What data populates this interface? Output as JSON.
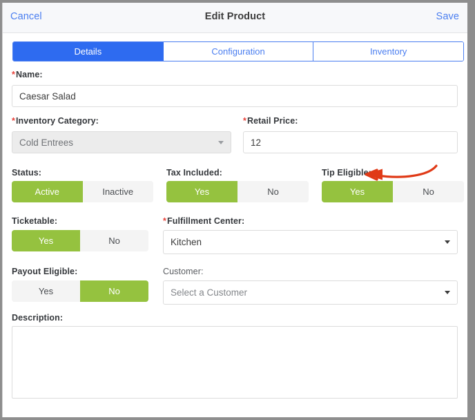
{
  "header": {
    "cancel_label": "Cancel",
    "title": "Edit Product",
    "save_label": "Save"
  },
  "tabs": [
    {
      "label": "Details",
      "active": true
    },
    {
      "label": "Configuration",
      "active": false
    },
    {
      "label": "Inventory",
      "active": false
    }
  ],
  "fields": {
    "name": {
      "label": "Name:",
      "required": "*",
      "value": "Caesar Salad"
    },
    "inventory_category": {
      "label": "Inventory Category:",
      "required": "*",
      "value": "Cold Entrees",
      "disabled": true
    },
    "retail_price": {
      "label": "Retail Price:",
      "required": "*",
      "value": "12"
    },
    "status": {
      "label": "Status:",
      "options": [
        "Active",
        "Inactive"
      ],
      "selected": "Active"
    },
    "tax_included": {
      "label": "Tax Included:",
      "options": [
        "Yes",
        "No"
      ],
      "selected": "Yes"
    },
    "tip_eligible": {
      "label": "Tip Eligible:",
      "options": [
        "Yes",
        "No"
      ],
      "selected": "Yes"
    },
    "ticketable": {
      "label": "Ticketable:",
      "options": [
        "Yes",
        "No"
      ],
      "selected": "Yes"
    },
    "fulfillment_center": {
      "label": "Fulfillment Center:",
      "required": "*",
      "value": "Kitchen"
    },
    "payout_eligible": {
      "label": "Payout Eligible:",
      "options": [
        "Yes",
        "No"
      ],
      "selected": "No"
    },
    "customer": {
      "label": "Customer:",
      "placeholder": "Select a Customer",
      "value": ""
    },
    "description": {
      "label": "Description:",
      "value": "",
      "placeholder": ""
    }
  },
  "annotation": {
    "type": "arrow",
    "color": "#e03a17",
    "points_to": "Tip Eligible:"
  },
  "colors": {
    "accent_blue": "#2e6bf0",
    "link_blue": "#4a7ef0",
    "toggle_green": "#95c23f",
    "required_red": "#e8413a",
    "annotation_red": "#e03a17"
  }
}
